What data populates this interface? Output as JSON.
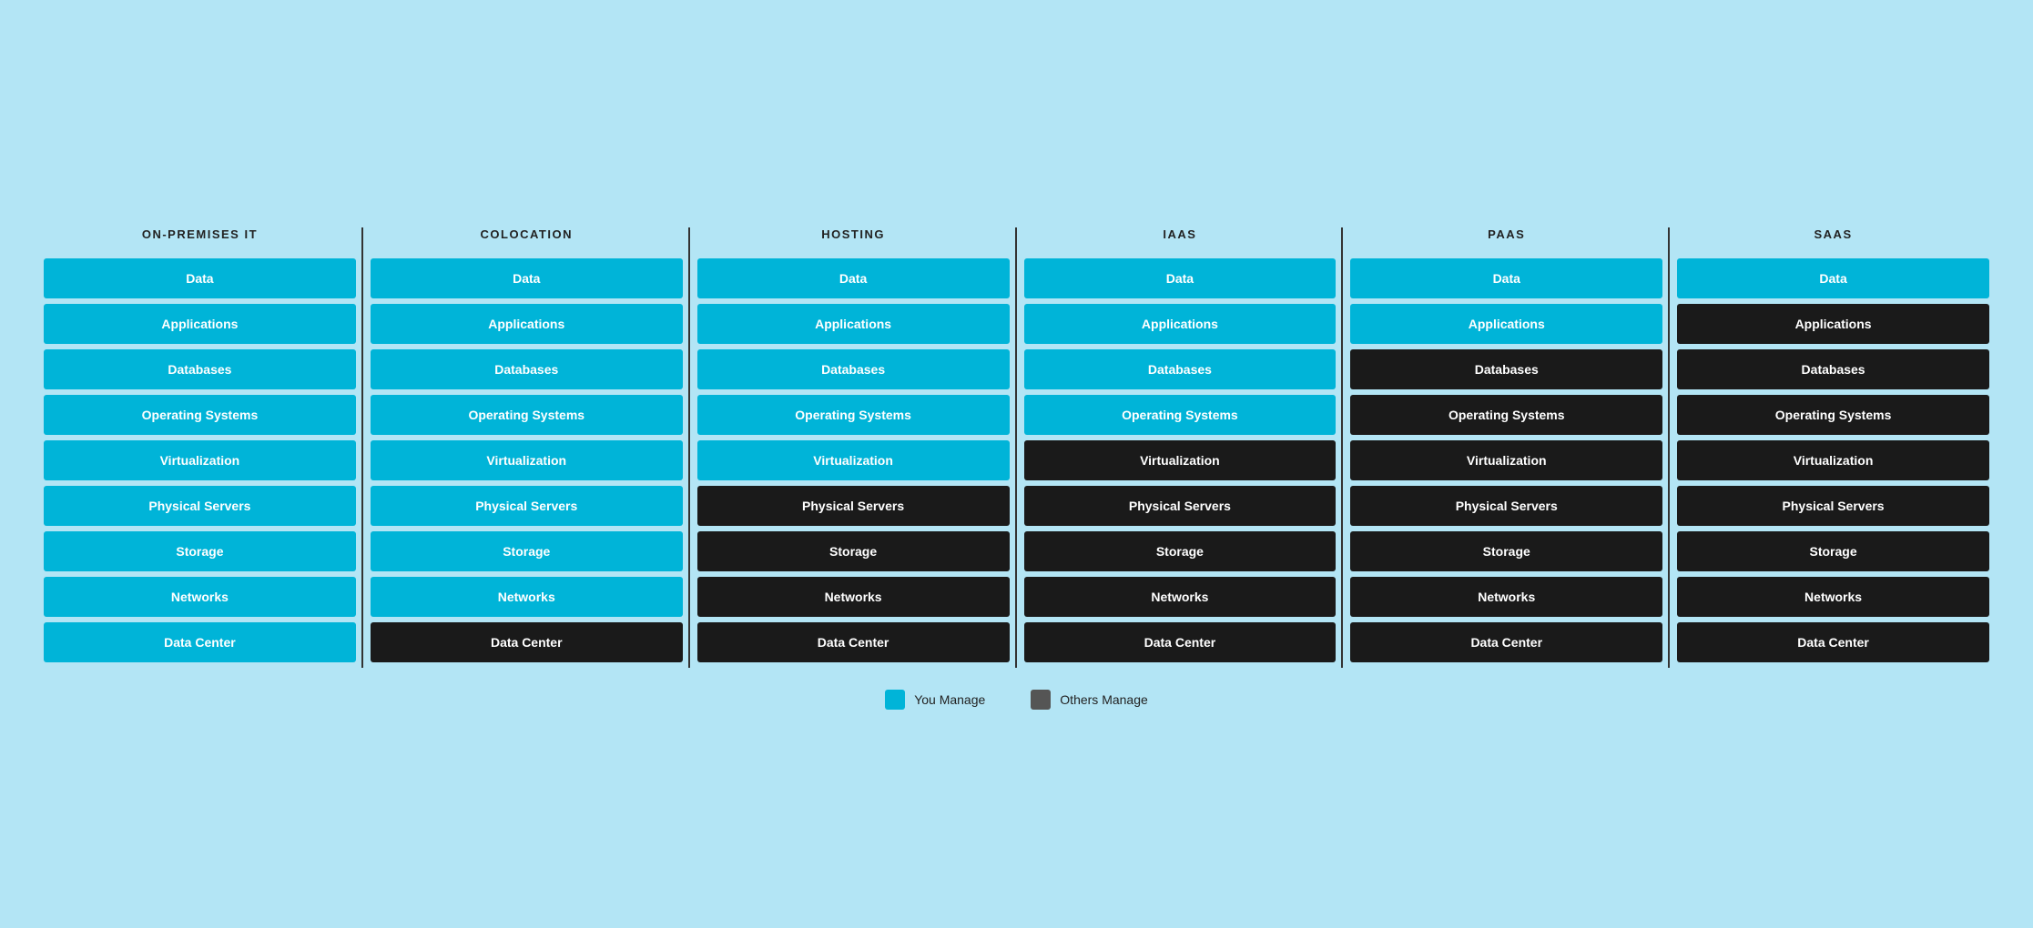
{
  "columns": [
    {
      "id": "on-premises",
      "header": "ON-PREMISES IT",
      "cells": [
        {
          "label": "Data",
          "type": "blue"
        },
        {
          "label": "Applications",
          "type": "blue"
        },
        {
          "label": "Databases",
          "type": "blue"
        },
        {
          "label": "Operating Systems",
          "type": "blue"
        },
        {
          "label": "Virtualization",
          "type": "blue"
        },
        {
          "label": "Physical Servers",
          "type": "blue"
        },
        {
          "label": "Storage",
          "type": "blue"
        },
        {
          "label": "Networks",
          "type": "blue"
        },
        {
          "label": "Data Center",
          "type": "blue"
        }
      ]
    },
    {
      "id": "colocation",
      "header": "COLOCATION",
      "cells": [
        {
          "label": "Data",
          "type": "blue"
        },
        {
          "label": "Applications",
          "type": "blue"
        },
        {
          "label": "Databases",
          "type": "blue"
        },
        {
          "label": "Operating Systems",
          "type": "blue"
        },
        {
          "label": "Virtualization",
          "type": "blue"
        },
        {
          "label": "Physical Servers",
          "type": "blue"
        },
        {
          "label": "Storage",
          "type": "blue"
        },
        {
          "label": "Networks",
          "type": "blue"
        },
        {
          "label": "Data Center",
          "type": "dark"
        }
      ]
    },
    {
      "id": "hosting",
      "header": "HOSTING",
      "cells": [
        {
          "label": "Data",
          "type": "blue"
        },
        {
          "label": "Applications",
          "type": "blue"
        },
        {
          "label": "Databases",
          "type": "blue"
        },
        {
          "label": "Operating Systems",
          "type": "blue"
        },
        {
          "label": "Virtualization",
          "type": "blue"
        },
        {
          "label": "Physical Servers",
          "type": "dark"
        },
        {
          "label": "Storage",
          "type": "dark"
        },
        {
          "label": "Networks",
          "type": "dark"
        },
        {
          "label": "Data Center",
          "type": "dark"
        }
      ]
    },
    {
      "id": "iaas",
      "header": "IaaS",
      "cells": [
        {
          "label": "Data",
          "type": "blue"
        },
        {
          "label": "Applications",
          "type": "blue"
        },
        {
          "label": "Databases",
          "type": "blue"
        },
        {
          "label": "Operating Systems",
          "type": "blue"
        },
        {
          "label": "Virtualization",
          "type": "dark"
        },
        {
          "label": "Physical Servers",
          "type": "dark"
        },
        {
          "label": "Storage",
          "type": "dark"
        },
        {
          "label": "Networks",
          "type": "dark"
        },
        {
          "label": "Data Center",
          "type": "dark"
        }
      ]
    },
    {
      "id": "paas",
      "header": "PaaS",
      "cells": [
        {
          "label": "Data",
          "type": "blue"
        },
        {
          "label": "Applications",
          "type": "blue"
        },
        {
          "label": "Databases",
          "type": "dark"
        },
        {
          "label": "Operating Systems",
          "type": "dark"
        },
        {
          "label": "Virtualization",
          "type": "dark"
        },
        {
          "label": "Physical Servers",
          "type": "dark"
        },
        {
          "label": "Storage",
          "type": "dark"
        },
        {
          "label": "Networks",
          "type": "dark"
        },
        {
          "label": "Data Center",
          "type": "dark"
        }
      ]
    },
    {
      "id": "saas",
      "header": "SaaS",
      "cells": [
        {
          "label": "Data",
          "type": "blue"
        },
        {
          "label": "Applications",
          "type": "dark"
        },
        {
          "label": "Databases",
          "type": "dark"
        },
        {
          "label": "Operating Systems",
          "type": "dark"
        },
        {
          "label": "Virtualization",
          "type": "dark"
        },
        {
          "label": "Physical Servers",
          "type": "dark"
        },
        {
          "label": "Storage",
          "type": "dark"
        },
        {
          "label": "Networks",
          "type": "dark"
        },
        {
          "label": "Data Center",
          "type": "dark"
        }
      ]
    }
  ],
  "legend": {
    "you_manage_label": "You Manage",
    "others_manage_label": "Others Manage"
  }
}
